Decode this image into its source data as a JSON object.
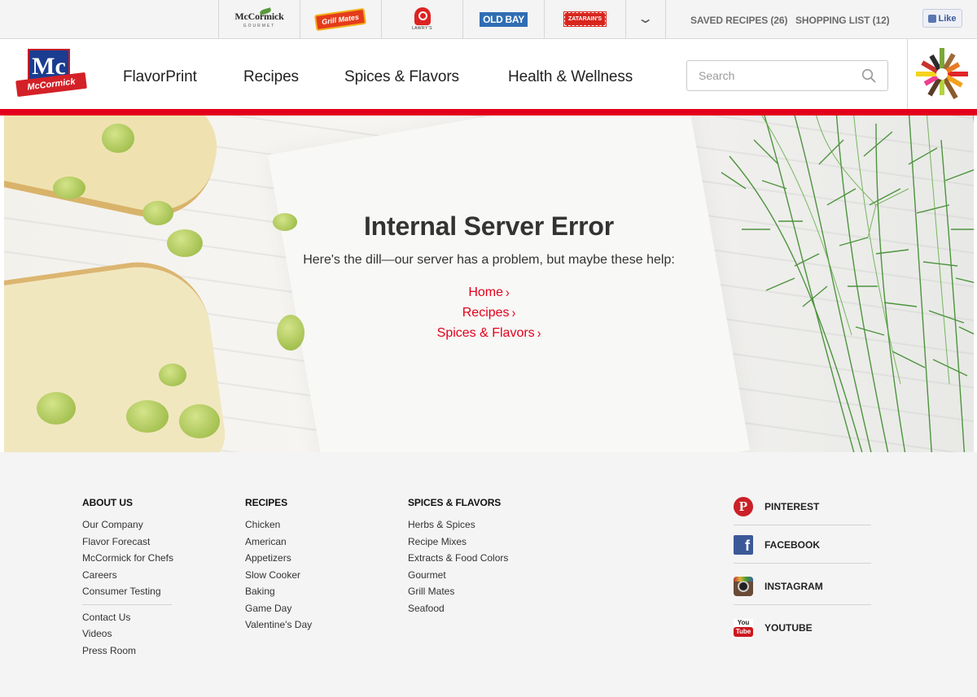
{
  "brands": {
    "mccormick_gourmet": {
      "line1": "McCormick",
      "line2": "GOURMET"
    },
    "grill_mates": "Grill Mates",
    "lawrys": "LAWRY'S",
    "old_bay": "OLD BAY",
    "zatarains": "ZATARAIN'S"
  },
  "toplinks": {
    "saved": "SAVED RECIPES (26)",
    "shopping": "SHOPPING LIST (12)",
    "like": "Like"
  },
  "logo": {
    "mark": "Mc",
    "ribbon": "McCormick"
  },
  "nav": [
    {
      "label": "FlavorPrint"
    },
    {
      "label": "Recipes"
    },
    {
      "label": "Spices & Flavors"
    },
    {
      "label": "Health & Wellness"
    }
  ],
  "search": {
    "placeholder": "Search",
    "value": ""
  },
  "hero": {
    "title": "Internal Server Error",
    "subtitle": "Here's the dill—our server has a problem, but maybe these help:",
    "links": [
      {
        "label": "Home"
      },
      {
        "label": "Recipes"
      },
      {
        "label": "Spices & Flavors"
      }
    ]
  },
  "footer": {
    "about": {
      "heading": "ABOUT US",
      "items": [
        "Our Company",
        "Flavor Forecast",
        "McCormick for Chefs",
        "Careers",
        "Consumer Testing"
      ],
      "items2": [
        "Contact Us",
        "Videos",
        "Press Room"
      ]
    },
    "recipes": {
      "heading": "RECIPES",
      "items": [
        "Chicken",
        "American",
        "Appetizers",
        "Slow Cooker",
        "Baking",
        "Game Day",
        "Valentine's Day"
      ]
    },
    "spices": {
      "heading": "SPICES & FLAVORS",
      "items": [
        "Herbs & Spices",
        "Recipe Mixes",
        "Extracts & Food Colors",
        "Gourmet",
        "Grill Mates",
        "Seafood"
      ]
    },
    "social": [
      {
        "label": "PINTEREST",
        "icon": "pinterest-icon"
      },
      {
        "label": "FACEBOOK",
        "icon": "facebook-icon"
      },
      {
        "label": "INSTAGRAM",
        "icon": "instagram-icon"
      },
      {
        "label": "YOUTUBE",
        "icon": "youtube-icon"
      }
    ]
  },
  "colors": {
    "accent_red": "#e3001b",
    "brand_blue": "#1a3d91",
    "footer_bg": "#f4f4f4"
  }
}
